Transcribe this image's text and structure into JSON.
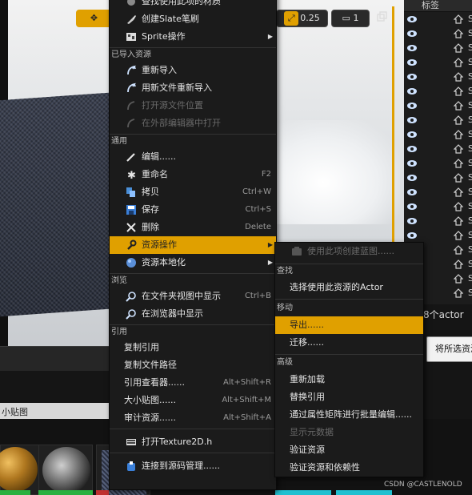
{
  "viewport": {
    "toolbar": {
      "scale_value": "0.25",
      "camera_value": "1"
    }
  },
  "outliner": {
    "header_label": "标签",
    "rows": [
      "S",
      "S",
      "S",
      "S",
      "S",
      "S",
      "S",
      "S",
      "S",
      "S",
      "S",
      "S",
      "S",
      "S",
      "S",
      "S",
      "S",
      "S",
      "S",
      "S"
    ],
    "actor_count": "8个actor",
    "select_all_button": "将所选资源"
  },
  "content_browser": {
    "search_text": "小贴图"
  },
  "context_menu": {
    "items_top": [
      {
        "label": "查找使用此项的材质",
        "icon": "material-icon"
      },
      {
        "label": "创建Slate笔刷",
        "icon": "brush-icon"
      },
      {
        "label": "Sprite操作",
        "icon": "sprite-icon",
        "submenu": true
      }
    ],
    "section_imported": "已导入资源",
    "items_imported": [
      {
        "label": "重新导入",
        "icon": "reimport-icon"
      },
      {
        "label": "用新文件重新导入",
        "icon": "reimport-icon"
      },
      {
        "label": "打开源文件位置",
        "icon": "folder-icon",
        "disabled": true
      },
      {
        "label": "在外部编辑器中打开",
        "icon": "external-editor-icon",
        "disabled": true
      }
    ],
    "section_common": "通用",
    "items_common": [
      {
        "label": "编辑......",
        "icon": "edit-icon",
        "shortcut": ""
      },
      {
        "label": "重命名",
        "icon": "rename-icon",
        "shortcut": "F2"
      },
      {
        "label": "拷贝",
        "icon": "copy-icon",
        "shortcut": "Ctrl+W"
      },
      {
        "label": "保存",
        "icon": "save-icon",
        "shortcut": "Ctrl+S"
      },
      {
        "label": "删除",
        "icon": "delete-icon",
        "shortcut": "Delete"
      },
      {
        "label": "资源操作",
        "icon": "wrench-icon",
        "submenu": true,
        "highlighted": true
      },
      {
        "label": "资源本地化",
        "icon": "globe-icon",
        "submenu": true
      }
    ],
    "section_browse": "浏览",
    "items_browse": [
      {
        "label": "在文件夹视图中显示",
        "icon": "search-icon",
        "shortcut": "Ctrl+B"
      },
      {
        "label": "在浏览器中显示",
        "icon": "search-icon",
        "shortcut": ""
      }
    ],
    "section_reference": "引用",
    "items_reference": [
      {
        "label": "复制引用",
        "shortcut": ""
      },
      {
        "label": "复制文件路径",
        "shortcut": ""
      },
      {
        "label": "引用查看器......",
        "shortcut": "Alt+Shift+R"
      },
      {
        "label": "大小贴图......",
        "shortcut": "Alt+Shift+M"
      },
      {
        "label": "审计资源......",
        "shortcut": "Alt+Shift+A"
      }
    ],
    "item_open_header": "打开Texture2D.h",
    "item_source_control": "连接到源码管理......"
  },
  "asset_actions_submenu": {
    "item_create_blueprint": "使用此项创建蓝图......",
    "section_find": "查找",
    "item_select_actor": "选择使用此资源的Actor",
    "section_move": "移动",
    "item_export": "导出......",
    "item_migrate": "迁移......",
    "section_advanced": "高级",
    "item_reload": "重新加载",
    "item_replace_refs": "替换引用",
    "item_bulk_edit": "通过属性矩阵进行批量编辑......",
    "item_show_metadata": "显示元数据",
    "item_validate": "验证资源",
    "item_validate_deps": "验证资源和依赖性"
  },
  "watermark": "CSDN @CASTLENOLD",
  "colors": {
    "accent": "#e0a000",
    "menu_bg": "#1b1b1b"
  }
}
